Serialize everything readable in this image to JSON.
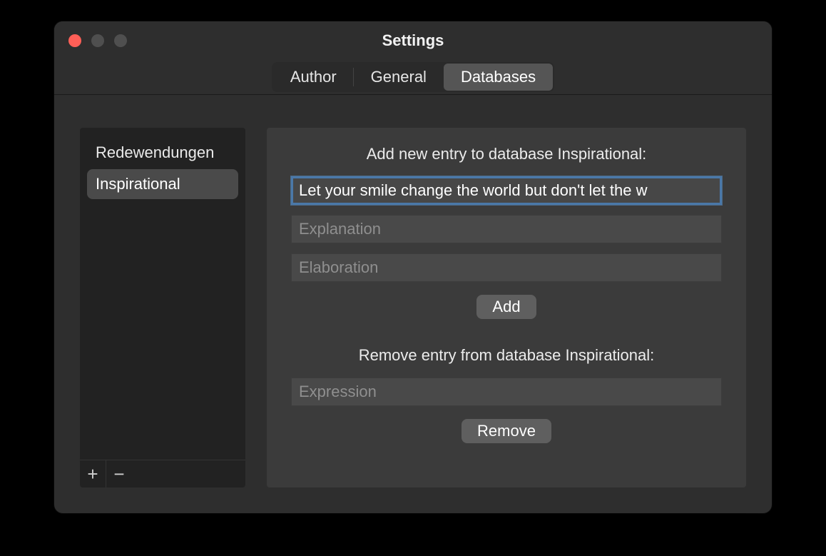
{
  "window": {
    "title": "Settings"
  },
  "tabs": {
    "author": "Author",
    "general": "General",
    "databases": "Databases"
  },
  "sidebar": {
    "items": [
      {
        "label": "Redewendungen"
      },
      {
        "label": "Inspirational"
      }
    ]
  },
  "panel": {
    "add_heading": "Add new entry to database Inspirational:",
    "entry_value": "Let your smile change the world but don't let the w",
    "explanation_placeholder": "Explanation",
    "elaboration_placeholder": "Elaboration",
    "add_button": "Add",
    "remove_heading": "Remove entry from database Inspirational:",
    "expression_placeholder": "Expression",
    "remove_button": "Remove"
  },
  "footer": {
    "add_icon": "+",
    "remove_icon": "−"
  }
}
